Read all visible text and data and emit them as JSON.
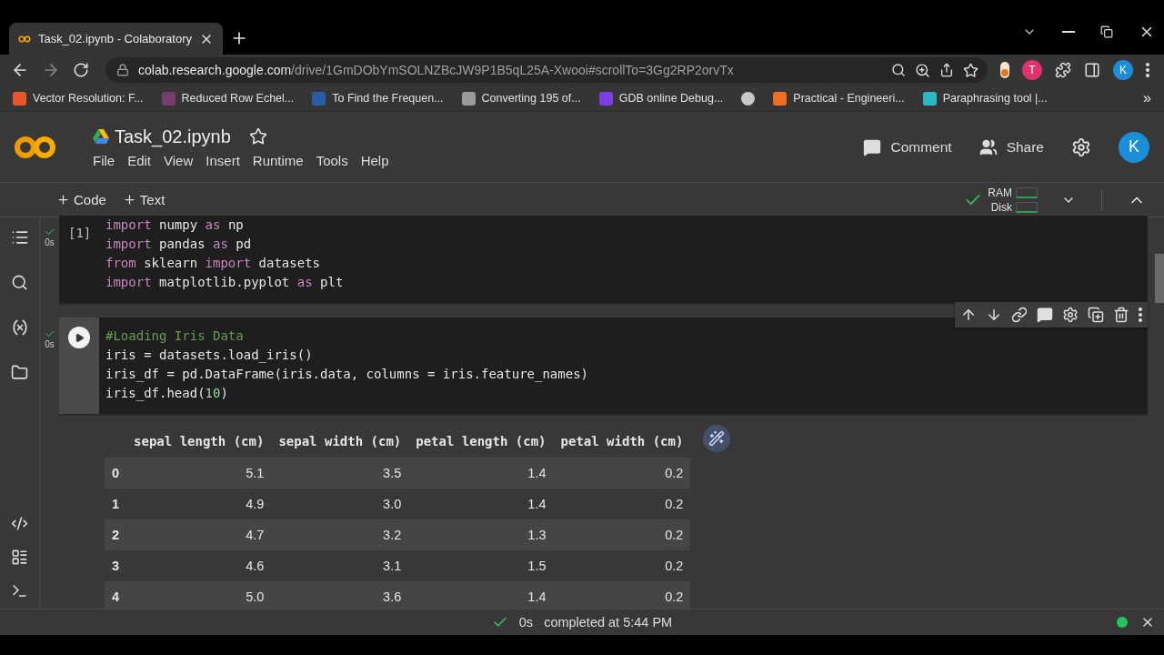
{
  "browser": {
    "tab": {
      "title": "Task_02.ipynb - Colaboratory"
    },
    "address": {
      "host": "colab.research.google.com",
      "path": "/drive/1GmDObYmSOLNZBcJW9P1B5qL25A-Xwooi#scrollTo=3Gg2RP2orvTx"
    },
    "extension_letter": "T",
    "profile_letter": "K",
    "bookmarks": [
      {
        "label": "Vector Resolution: F...",
        "color": "#e8562a"
      },
      {
        "label": "Reduced Row Echel...",
        "color": "#7a3b6e"
      },
      {
        "label": "To Find the Frequen...",
        "color": "#2a5caa"
      },
      {
        "label": "Converting 195 of...",
        "color": "#9a9a9a"
      },
      {
        "label": "GDB online Debug...",
        "color": "#7b3fe4"
      },
      {
        "color": "#c8c8c8"
      },
      {
        "label": "Practical - Engineeri...",
        "color": "#f26d21"
      },
      {
        "label": "Paraphrasing tool |...",
        "color": "#2bb8c4"
      }
    ],
    "bookmarks_more": "»"
  },
  "notebook": {
    "title": "Task_02.ipynb",
    "starred": false,
    "menu": [
      "File",
      "Edit",
      "View",
      "Insert",
      "Runtime",
      "Tools",
      "Help"
    ],
    "actions": [
      {
        "label": "Comment",
        "kind": "comment"
      },
      {
        "label": "Share",
        "kind": "share"
      }
    ],
    "avatar": "K",
    "add_buttons": [
      "Code",
      "Text"
    ],
    "resources": {
      "connected": true,
      "labels": [
        "RAM",
        "Disk"
      ]
    }
  },
  "cells": [
    {
      "selected": false,
      "count": "[1]",
      "time": "0s",
      "lines": [
        [
          {
            "text": "import",
            "kind": "keyword"
          },
          {
            "text": " numpy ",
            "kind": "name"
          },
          {
            "text": "as",
            "kind": "keyword"
          },
          {
            "text": " np",
            "kind": "name"
          }
        ],
        [
          {
            "text": "import",
            "kind": "keyword"
          },
          {
            "text": " pandas ",
            "kind": "name"
          },
          {
            "text": "as",
            "kind": "keyword"
          },
          {
            "text": " pd",
            "kind": "name"
          }
        ],
        [
          {
            "text": "from",
            "kind": "keyword"
          },
          {
            "text": " sklearn ",
            "kind": "name"
          },
          {
            "text": "import",
            "kind": "keyword"
          },
          {
            "text": " datasets",
            "kind": "name"
          }
        ],
        [
          {
            "text": "import",
            "kind": "keyword"
          },
          {
            "text": " matplotlib.pyplot ",
            "kind": "name"
          },
          {
            "text": "as",
            "kind": "keyword"
          },
          {
            "text": " plt",
            "kind": "name"
          }
        ]
      ]
    },
    {
      "selected": true,
      "time": "0s",
      "lines": [
        [
          {
            "text": "#Loading Iris Data",
            "kind": "comment"
          }
        ],
        [
          {
            "text": "iris = datasets.load_iris()",
            "kind": "name"
          }
        ],
        [
          {
            "text": "iris_df = pd.DataFrame(iris.data, columns = iris.feature_names)",
            "kind": "name"
          }
        ],
        [
          {
            "text": "iris_df.head(",
            "kind": "name"
          },
          {
            "text": "10",
            "kind": "number"
          },
          {
            "text": ")",
            "kind": "name"
          }
        ]
      ],
      "output": {
        "columns": [
          "sepal length (cm)",
          "sepal width (cm)",
          "petal length (cm)",
          "petal width (cm)"
        ],
        "rows": [
          {
            "index": "0",
            "values": [
              "5.1",
              "3.5",
              "1.4",
              "0.2"
            ]
          },
          {
            "index": "1",
            "values": [
              "4.9",
              "3.0",
              "1.4",
              "0.2"
            ]
          },
          {
            "index": "2",
            "values": [
              "4.7",
              "3.2",
              "1.3",
              "0.2"
            ]
          },
          {
            "index": "3",
            "values": [
              "4.6",
              "3.1",
              "1.5",
              "0.2"
            ]
          },
          {
            "index": "4",
            "values": [
              "5.0",
              "3.6",
              "1.4",
              "0.2"
            ]
          }
        ]
      }
    }
  ],
  "status_bar": {
    "ok": true,
    "time": "0s",
    "message": "completed at 5:44 PM",
    "connected": true
  }
}
